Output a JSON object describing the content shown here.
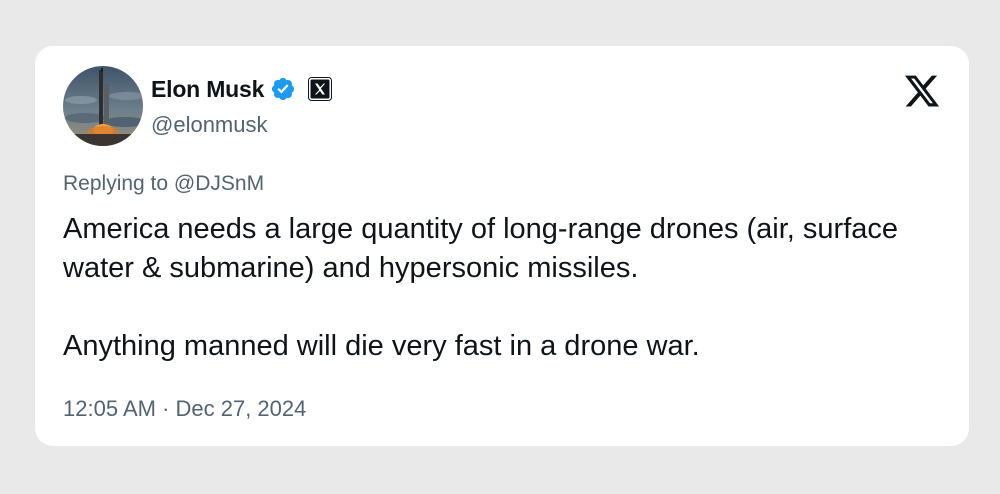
{
  "tweet": {
    "author": {
      "display_name": "Elon Musk",
      "handle": "@elonmusk",
      "avatar_icon": "rocket-launch-avatar",
      "verified_color": "#1d9bf0"
    },
    "reply_context": "Replying to @DJSnM",
    "text": "America needs a large quantity of long-range drones (air, surface water & submarine) and hypersonic missiles.\n\nAnything manned will die very fast in a drone war.",
    "timestamp": "12:05 AM · Dec 27, 2024"
  },
  "icons": {
    "verified": "verified-badge-icon",
    "affiliation": "x-affiliation-icon",
    "brand": "x-logo-icon"
  }
}
